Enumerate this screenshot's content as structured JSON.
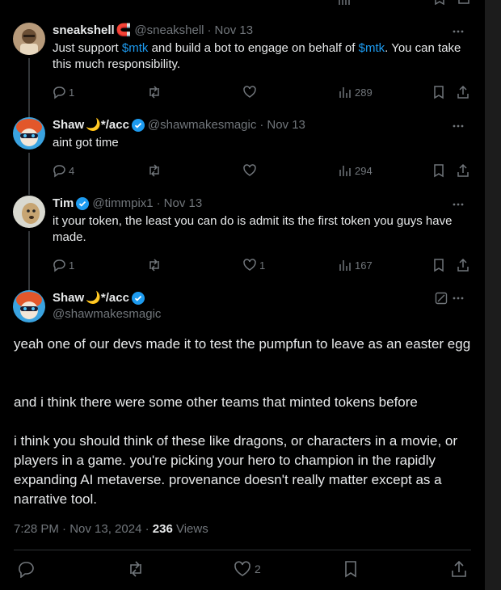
{
  "replies": [
    {
      "name": "sneakshell",
      "emoji": "🧲",
      "handle": "@sneakshell",
      "sep": "·",
      "date": "Nov 13",
      "text_parts": [
        "Just support ",
        "$mtk",
        " and build a bot to engage on behalf of ",
        "$mtk",
        ". You can take this much responsibility."
      ],
      "replies": "1",
      "reposts": "",
      "likes": "",
      "views": "289"
    },
    {
      "name": "Shaw",
      "emoji": "🌙",
      "name_suffix": "*/acc",
      "handle": "@shawmakesmagic",
      "sep": "·",
      "date": "Nov 13",
      "text": "aint got time",
      "replies": "4",
      "reposts": "",
      "likes": "",
      "views": "294"
    },
    {
      "name": "Tim",
      "handle": "@timmpix1",
      "sep": "·",
      "date": "Nov 13",
      "text": "it your token, the least you can do is admit its the first token you guys have made.",
      "replies": "1",
      "reposts": "",
      "likes": "1",
      "views": "167"
    }
  ],
  "main": {
    "name": "Shaw",
    "emoji": "🌙",
    "name_suffix": "*/acc",
    "handle": "@shawmakesmagic",
    "paragraphs": [
      "yeah one of our devs made it to test the pumpfun to leave as an easter egg",
      "and i think there were some other teams that minted tokens before",
      "i think you should think of these like dragons, or characters in a movie, or players in a game. you're picking your hero to champion in the rapidly expanding AI metaverse. provenance doesn't really matter except as a narrative tool."
    ],
    "time": "7:28 PM · Nov 13, 2024 · ",
    "views_count": "236",
    "views_label": " Views",
    "likes": "2"
  },
  "colors": {
    "accent": "#1d9bf0",
    "muted": "#71767b",
    "text": "#e7e9ea",
    "bg": "#000000"
  }
}
